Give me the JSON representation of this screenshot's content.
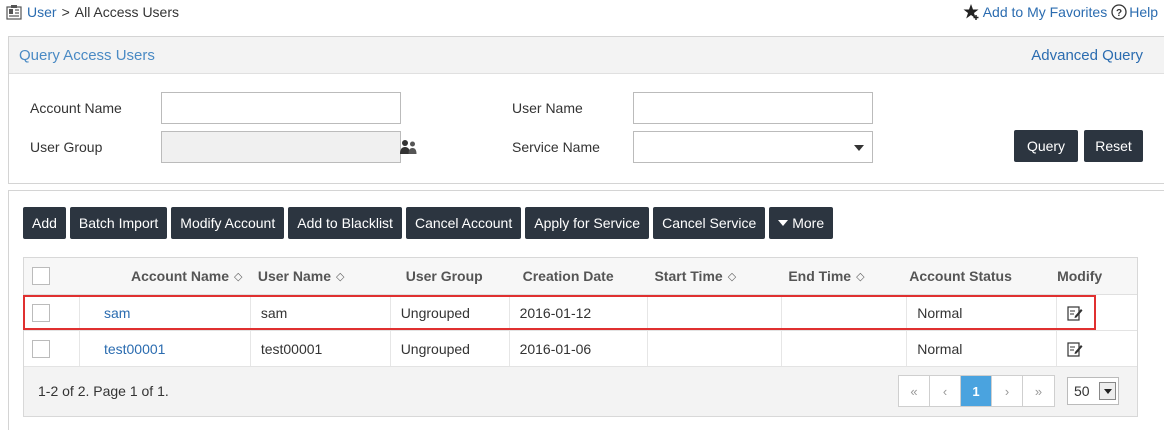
{
  "breadcrumb": {
    "root": "User",
    "separator": ">",
    "current": "All Access Users"
  },
  "toplinks": {
    "favorites": "Add to My Favorites",
    "help": "Help"
  },
  "query": {
    "title": "Query Access Users",
    "advanced_link": "Advanced Query",
    "account_name_label": "Account Name",
    "account_name_value": "",
    "user_name_label": "User Name",
    "user_name_value": "",
    "user_group_label": "User Group",
    "user_group_value": "",
    "service_name_label": "Service Name",
    "service_name_value": "",
    "query_button": "Query",
    "reset_button": "Reset"
  },
  "toolbar": {
    "add": "Add",
    "batch_import": "Batch Import",
    "modify_account": "Modify Account",
    "add_blacklist": "Add to Blacklist",
    "cancel_account": "Cancel Account",
    "apply_service": "Apply for Service",
    "cancel_service": "Cancel Service",
    "more": "More"
  },
  "table": {
    "headers": {
      "account_name": "Account Name",
      "user_name": "User Name",
      "user_group": "User Group",
      "creation_date": "Creation Date",
      "start_time": "Start Time",
      "end_time": "End Time",
      "account_status": "Account Status",
      "modify": "Modify"
    },
    "sort_glyph": "◇",
    "rows": [
      {
        "account_name": "sam",
        "user_name": "sam",
        "user_group": "Ungrouped",
        "creation_date": "2016-01-12",
        "start_time": "",
        "end_time": "",
        "account_status": "Normal"
      },
      {
        "account_name": "test00001",
        "user_name": "test00001",
        "user_group": "Ungrouped",
        "creation_date": "2016-01-06",
        "start_time": "",
        "end_time": "",
        "account_status": "Normal"
      }
    ]
  },
  "pagination": {
    "summary": "1-2 of 2. Page 1 of 1.",
    "first": "«",
    "prev": "‹",
    "current_page": "1",
    "next": "›",
    "last": "»",
    "page_size": "50"
  },
  "colors": {
    "accent": "#2b6cb0",
    "button_dark": "#2c3540",
    "active_page": "#4aa3df",
    "highlight_border": "#e03030"
  }
}
